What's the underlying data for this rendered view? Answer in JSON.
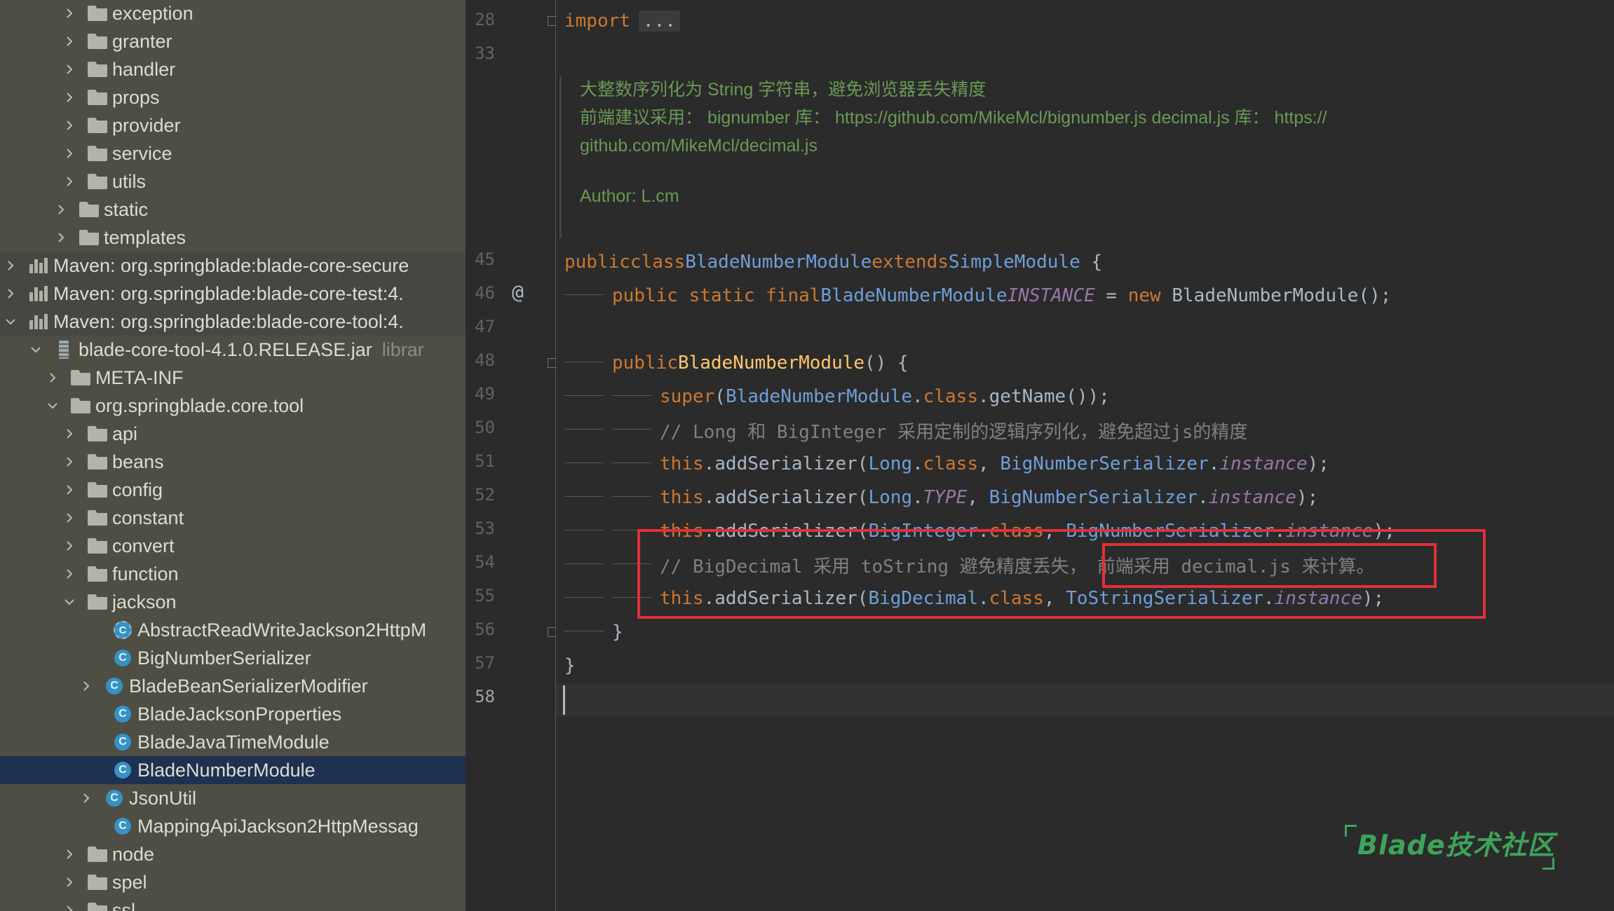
{
  "tree": {
    "items": [
      {
        "label": "exception",
        "icon": "folder"
      },
      {
        "label": "granter",
        "icon": "folder"
      },
      {
        "label": "handler",
        "icon": "folder"
      },
      {
        "label": "props",
        "icon": "folder"
      },
      {
        "label": "provider",
        "icon": "folder"
      },
      {
        "label": "service",
        "icon": "folder"
      },
      {
        "label": "utils",
        "icon": "folder"
      },
      {
        "label": "static",
        "icon": "folder"
      },
      {
        "label": "templates",
        "icon": "folder"
      },
      {
        "label": "Maven: org.springblade:blade-core-secure",
        "icon": "library"
      },
      {
        "label": "Maven: org.springblade:blade-core-test:4.",
        "icon": "library"
      },
      {
        "label": "Maven: org.springblade:blade-core-tool:4.",
        "icon": "library"
      },
      {
        "label": "blade-core-tool-4.1.0.RELEASE.jar",
        "hint": "librar",
        "icon": "jar"
      },
      {
        "label": "META-INF",
        "icon": "folder"
      },
      {
        "label": "org.springblade.core.tool",
        "icon": "folder"
      },
      {
        "label": "api",
        "icon": "folder"
      },
      {
        "label": "beans",
        "icon": "folder"
      },
      {
        "label": "config",
        "icon": "folder"
      },
      {
        "label": "constant",
        "icon": "folder"
      },
      {
        "label": "convert",
        "icon": "folder"
      },
      {
        "label": "function",
        "icon": "folder"
      },
      {
        "label": "jackson",
        "icon": "folder"
      },
      {
        "label": "AbstractReadWriteJackson2HttpM",
        "icon": "abstract-class"
      },
      {
        "label": "BigNumberSerializer",
        "icon": "class"
      },
      {
        "label": "BladeBeanSerializerModifier",
        "icon": "class"
      },
      {
        "label": "BladeJacksonProperties",
        "icon": "class"
      },
      {
        "label": "BladeJavaTimeModule",
        "icon": "class"
      },
      {
        "label": "BladeNumberModule",
        "icon": "class"
      },
      {
        "label": "JsonUtil",
        "icon": "class"
      },
      {
        "label": "MappingApiJackson2HttpMessag",
        "icon": "class"
      },
      {
        "label": "node",
        "icon": "folder"
      },
      {
        "label": "spel",
        "icon": "folder"
      },
      {
        "label": "ssl",
        "icon": "folder"
      }
    ]
  },
  "editor": {
    "line_numbers": [
      "28",
      "33",
      "45",
      "46",
      "47",
      "48",
      "49",
      "50",
      "51",
      "52",
      "53",
      "54",
      "55",
      "56",
      "57",
      "58"
    ],
    "gutter_at": "@",
    "import_kw": "import",
    "import_fold": "...",
    "doc": {
      "line1": "大整数序列化为 String 字符串，避免浏览器丢失精度",
      "line2": "前端建议采用： bignumber 库： https://github.com/MikeMcl/bignumber.js decimal.js 库： https://",
      "line3": "github.com/MikeMcl/decimal.js",
      "author": "Author: L.cm"
    },
    "code": {
      "l45": {
        "public": "public",
        "class_kw": "class",
        "name": "BladeNumberModule",
        "extends": "extends",
        "parent": "SimpleModule",
        "brace": " {"
      },
      "l46": {
        "mods": "public static final",
        "type": "BladeNumberModule",
        "field": "INSTANCE",
        "eq": " = ",
        "new_kw": "new",
        "rest": " BladeNumberModule();"
      },
      "l48": {
        "public": "public",
        "ctor": "BladeNumberModule",
        "rest": "() {"
      },
      "l49": {
        "super": "super",
        "open": "(",
        "cls": "BladeNumberModule",
        "dot": ".",
        "class_kw": "class",
        "rest": ".getName());"
      },
      "l50": {
        "comment": "// Long 和 BigInteger 采用定制的逻辑序列化，避免超过js的精度"
      },
      "l51": {
        "this": "this",
        "call": ".addSerializer(",
        "cls": "Long",
        "dot": ".",
        "class_kw": "class",
        "comma": ", ",
        "ser": "BigNumberSerializer",
        "dot2": ".",
        "inst": "instance",
        "end": ");"
      },
      "l52": {
        "this": "this",
        "call": ".addSerializer(",
        "cls": "Long",
        "dot": ".",
        "type": "TYPE",
        "comma": ", ",
        "ser": "BigNumberSerializer",
        "dot2": ".",
        "inst": "instance",
        "end": ");"
      },
      "l53": {
        "this": "this",
        "call": ".addSerializer(",
        "cls": "BigInteger",
        "dot": ".",
        "class_kw": "class",
        "comma": ", ",
        "ser": "BigNumberSerializer",
        "dot2": ".",
        "inst": "instance",
        "end": ");"
      },
      "l54": {
        "comment": "// BigDecimal 采用 toString 避免精度丢失，",
        "comment_box": "前端采用 decimal.js 来计算。"
      },
      "l55": {
        "this": "this",
        "call": ".addSerializer(",
        "cls": "BigDecimal",
        "dot": ".",
        "class_kw": "class",
        "comma": ", ",
        "ser": "ToStringSerializer",
        "dot2": ".",
        "inst": "instance",
        "end": ");"
      },
      "l56": {
        "brace": "}"
      },
      "l57": {
        "brace": "}"
      }
    }
  },
  "watermark": "Blade技术社区",
  "colors": {
    "highlight": "#e0303a",
    "keyword": "#cc7832",
    "doc": "#6a9955",
    "selected": "#1e3150"
  }
}
